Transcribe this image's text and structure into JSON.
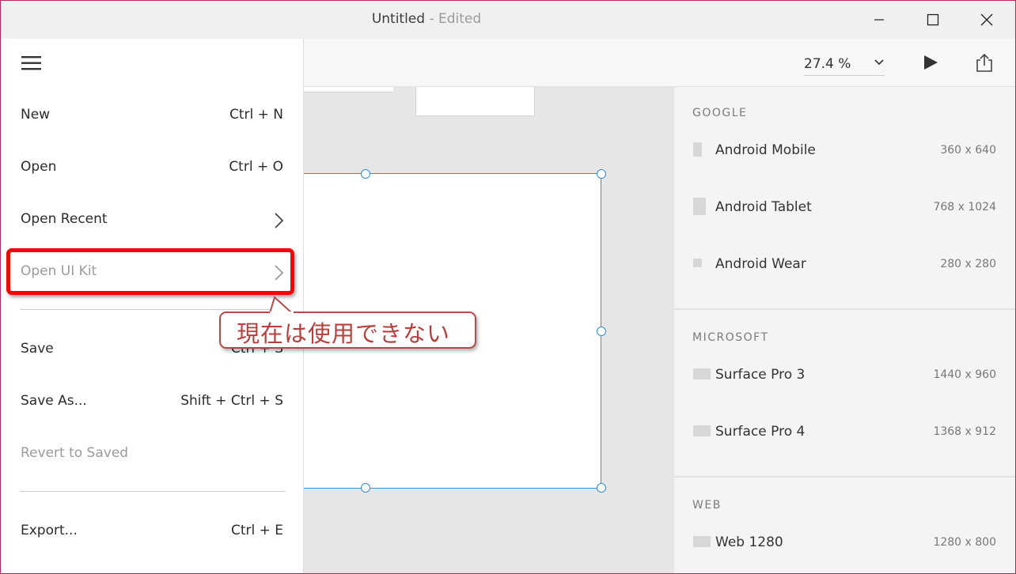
{
  "window": {
    "title": "Untitled",
    "status": " - Edited"
  },
  "toolbar": {
    "zoom_value": "27.4 %"
  },
  "menu": {
    "items": [
      {
        "label": "New",
        "shortcut": "Ctrl + N"
      },
      {
        "label": "Open",
        "shortcut": "Ctrl + O"
      },
      {
        "label": "Open Recent",
        "shortcut": ""
      },
      {
        "label": "Open UI Kit",
        "shortcut": ""
      },
      {
        "label": "Save",
        "shortcut": "Ctrl + S"
      },
      {
        "label": "Save As...",
        "shortcut": "Shift + Ctrl + S"
      },
      {
        "label": "Revert to Saved",
        "shortcut": ""
      },
      {
        "label": "Export...",
        "shortcut": "Ctrl + E"
      }
    ]
  },
  "annotation": {
    "text": "現在は使用できない"
  },
  "presets": {
    "sections": [
      {
        "title": "GOOGLE",
        "items": [
          {
            "name": "Android Mobile",
            "size": "360 x 640"
          },
          {
            "name": "Android Tablet",
            "size": "768 x 1024"
          },
          {
            "name": "Android Wear",
            "size": "280 x 280"
          }
        ]
      },
      {
        "title": "MICROSOFT",
        "items": [
          {
            "name": "Surface Pro 3",
            "size": "1440 x 960"
          },
          {
            "name": "Surface Pro 4",
            "size": "1368 x 912"
          }
        ]
      },
      {
        "title": "WEB",
        "items": [
          {
            "name": "Web 1280",
            "size": "1280 x 800"
          }
        ]
      }
    ]
  },
  "colors": {
    "highlight_red": "#ff0000",
    "callout_text": "#b5403d",
    "selection_blue": "#3b94d6"
  }
}
